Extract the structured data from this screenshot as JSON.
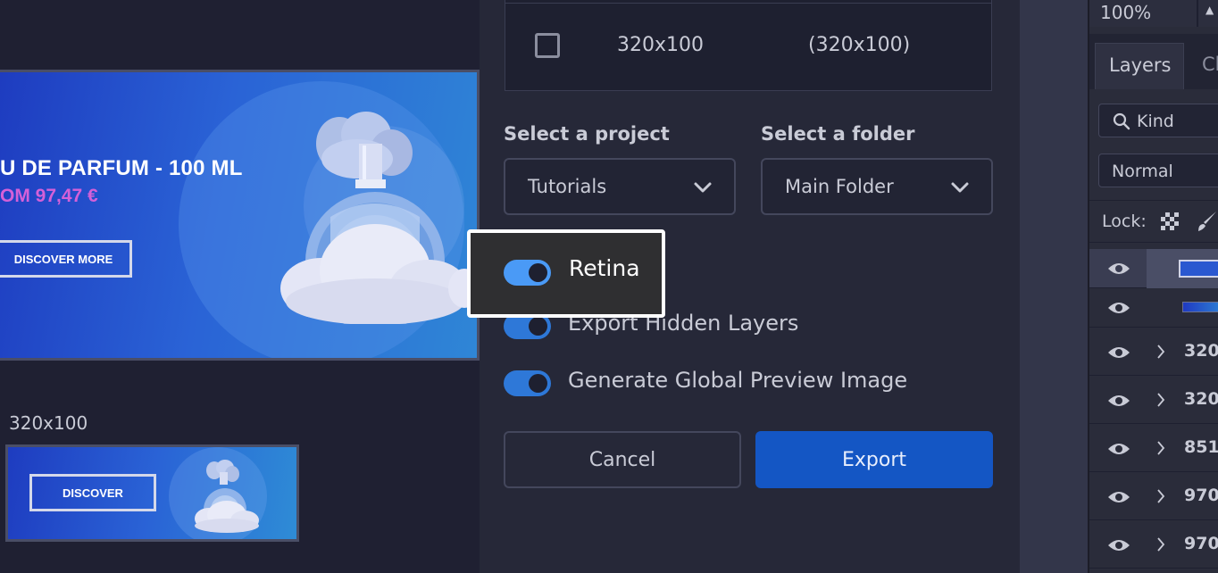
{
  "canvas": {
    "large_banner": {
      "headline": "U DE PARFUM - 100 ML",
      "price": "OM 97,47 €",
      "cta": "DISCOVER MORE"
    },
    "small_banner": {
      "label": "320x100",
      "cta": "DISCOVER"
    }
  },
  "dialog": {
    "size_row": {
      "name": "320x100",
      "dimensions": "(320x100)",
      "checked": false
    },
    "project_label": "Select a project",
    "project_value": "Tutorials",
    "folder_label": "Select a folder",
    "folder_value": "Main Folder",
    "toggles": [
      {
        "label": "Retina",
        "on": true
      },
      {
        "label": "Export Hidden Layers",
        "on": true
      },
      {
        "label": "Generate Global Preview Image",
        "on": true
      }
    ],
    "cancel_label": "Cancel",
    "export_label": "Export",
    "accent_color": "#1456c4"
  },
  "layers_panel": {
    "zoom": "100%",
    "tab_layers": "Layers",
    "tab_channels": "Ch",
    "filter_kind": "Kind",
    "blend_mode": "Normal",
    "lock_label": "Lock:",
    "rows": [
      {
        "name": "320"
      },
      {
        "name": "320"
      },
      {
        "name": "851:"
      },
      {
        "name": "970"
      },
      {
        "name": "970"
      }
    ]
  }
}
